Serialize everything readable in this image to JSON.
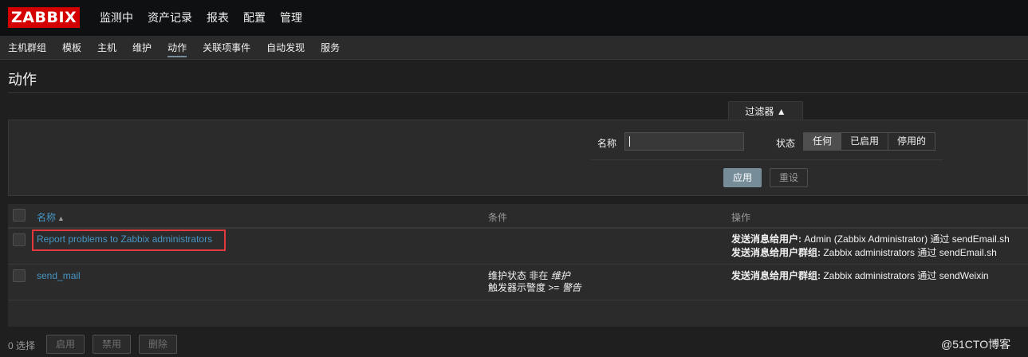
{
  "app": {
    "logo": "ZABBIX"
  },
  "main_nav": [
    "监测中",
    "资产记录",
    "报表",
    "配置",
    "管理"
  ],
  "sub_nav": [
    "主机群组",
    "模板",
    "主机",
    "维护",
    "动作",
    "关联项事件",
    "自动发现",
    "服务"
  ],
  "sub_nav_active": "动作",
  "page": {
    "title": "动作"
  },
  "filter": {
    "tab_label": "过滤器 ▲",
    "name_label": "名称",
    "name_value": "",
    "status_label": "状态",
    "status_options": [
      "任何",
      "已启用",
      "停用的"
    ],
    "status_selected": "任何",
    "apply_label": "应用",
    "reset_label": "重设"
  },
  "table": {
    "headers": {
      "name": "名称",
      "sort_indicator": "▲",
      "conditions": "条件",
      "operations": "操作"
    },
    "rows": [
      {
        "name": "Report problems to Zabbix administrators",
        "conditions": [],
        "operations": [
          {
            "label": "发送消息给用户:",
            "text": "Admin (Zabbix Administrator) 通过 sendEmail.sh"
          },
          {
            "label": "发送消息给用户群组:",
            "text": "Zabbix administrators 通过 sendEmail.sh"
          }
        ]
      },
      {
        "name": "send_mail",
        "conditions": [
          {
            "prefix": "维护状态 非在",
            "value": "维护"
          },
          {
            "prefix": "触发器示警度 >=",
            "value": "警告"
          }
        ],
        "operations": [
          {
            "label": "发送消息给用户群组:",
            "text": "Zabbix administrators 通过 sendWeixin"
          }
        ]
      }
    ]
  },
  "footer": {
    "selected_count": "0 选择",
    "enable_label": "启用",
    "disable_label": "禁用",
    "delete_label": "删除"
  },
  "watermark": "@51CTO博客",
  "colors": {
    "brand": "#d40000",
    "link": "#4796c4",
    "accent": "#768d99",
    "highlight_box": "#e4393c"
  }
}
